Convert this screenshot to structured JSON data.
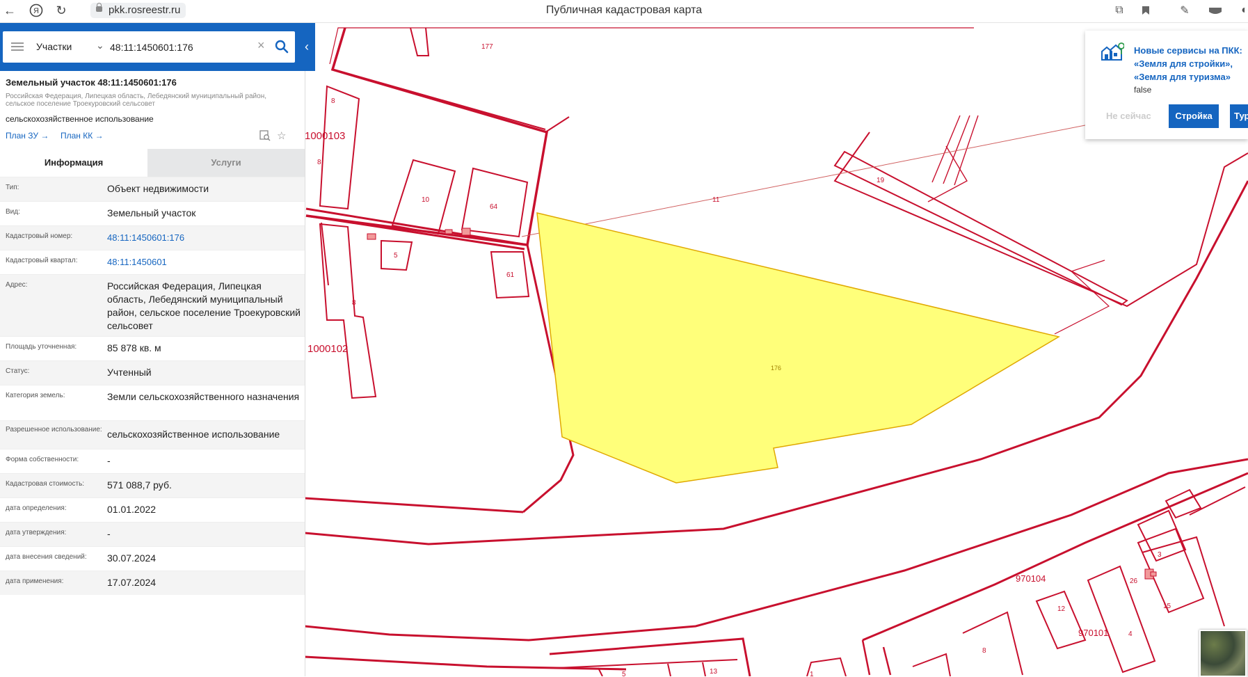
{
  "browser": {
    "url": "pkk.rosreestr.ru",
    "page_title": "Публичная кадастровая карта"
  },
  "search": {
    "type_label": "Участки",
    "query": "48:11:1450601:176"
  },
  "object": {
    "title": "Земельный участок 48:11:1450601:176",
    "address": "Российская Федерация, Липецкая область, Лебедянский муниципальный район, сельское поселение Троекуровский сельсовет",
    "use": "сельскохозяйственное использование",
    "plan_zu": "План ЗУ",
    "plan_kk": "План КК"
  },
  "tabs": {
    "info": "Информация",
    "services": "Услуги"
  },
  "rows": [
    {
      "label": "Тип:",
      "value": "Объект недвижимости"
    },
    {
      "label": "Вид:",
      "value": "Земельный участок"
    },
    {
      "label": "Кадастровый номер:",
      "value": "48:11:1450601:176"
    },
    {
      "label": "Кадастровый квартал:",
      "value": "48:11:1450601"
    },
    {
      "label": "Адрес:",
      "value": "Российская Федерация, Липецкая область, Лебедянский муниципальный район, сельское поселение Троекуровский сельсовет"
    },
    {
      "label": "Площадь уточненная:",
      "value": "85 878 кв. м"
    },
    {
      "label": "Статус:",
      "value": "Учтенный"
    },
    {
      "label": "Категория земель:",
      "value": "Земли сельскохозяйственного назначения"
    },
    {
      "label": "Разрешенное использование:",
      "value": "сельскохозяйственное использование"
    },
    {
      "label": "Форма собственности:",
      "value": "-"
    },
    {
      "label": "Кадастровая стоимость:",
      "value": "571 088,7 руб."
    },
    {
      "label": "дата определения:",
      "value": "01.01.2022"
    },
    {
      "label": "дата утверждения:",
      "value": "-"
    },
    {
      "label": "дата внесения сведений:",
      "value": "30.07.2024"
    },
    {
      "label": "дата применения:",
      "value": "17.07.2024"
    }
  ],
  "notification": {
    "title_line1": "Новые сервисы на ПКК:",
    "title_line2": "«Земля для стройки»,",
    "title_line3": "«Земля для туризма»",
    "extra": "false",
    "later": "Не сейчас",
    "btn_build": "Стройка",
    "btn_tourism": "Туризм"
  },
  "map_labels": {
    "l177": "177",
    "l8a": "8",
    "l1000103": "1000103",
    "l8b": "8",
    "l10": "10",
    "l64": "64",
    "l11": "11",
    "l19": "19",
    "l5": "5",
    "l61": "61",
    "l8c": "8",
    "l1000102": "1000102",
    "l176": "176",
    "l970104": "970104",
    "l3": "3",
    "l26": "26",
    "l15": "15",
    "l12": "12",
    "l970101": "970101",
    "l4": "4",
    "l8d": "8",
    "l13": "13",
    "l5b": "5",
    "l1": "1"
  },
  "colors": {
    "accent": "#1565c0",
    "parcel_border": "#c8102e",
    "selected_fill": "#ffff7a",
    "selected_border": "#e0a800"
  },
  "icons": {
    "back": "arrow-left-icon",
    "yandex": "yandex-icon",
    "reload": "reload-icon",
    "lock": "lock-icon",
    "menu": "menu-icon",
    "search": "search-icon",
    "clear": "close-icon",
    "collapse": "chevron-left-icon",
    "map_search": "map-search-icon",
    "favorite": "star-icon"
  }
}
